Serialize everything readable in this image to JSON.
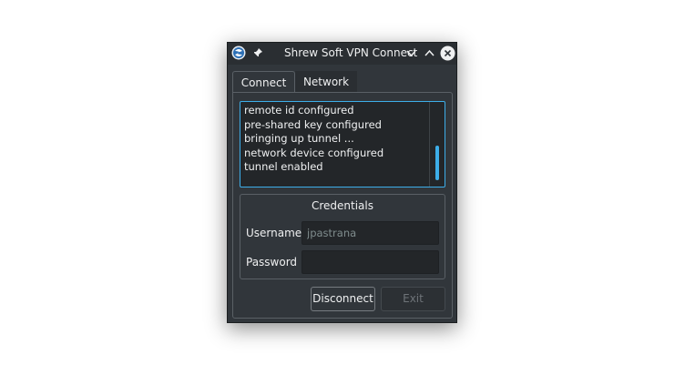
{
  "window": {
    "title": "Shrew Soft VPN Connect",
    "accent_color": "#3daee9",
    "background_color": "#31363b"
  },
  "titlebar": {
    "icons": [
      "shrew-soft-app-icon",
      "pin-icon",
      "chevron-down-icon",
      "chevron-up-icon",
      "close-icon"
    ]
  },
  "tabs": [
    {
      "label": "Connect",
      "active": true
    },
    {
      "label": "Network",
      "active": false
    }
  ],
  "log": {
    "lines": [
      "remote id configured",
      "pre-shared key configured",
      "bringing up tunnel ...",
      "network device configured",
      "tunnel enabled"
    ]
  },
  "credentials": {
    "title": "Credentials",
    "username_label": "Username",
    "username_placeholder": "jpastrana",
    "username_value": "",
    "password_label": "Password",
    "password_value": ""
  },
  "buttons": {
    "disconnect_label": "Disconnect",
    "exit_label": "Exit",
    "exit_enabled": false
  }
}
